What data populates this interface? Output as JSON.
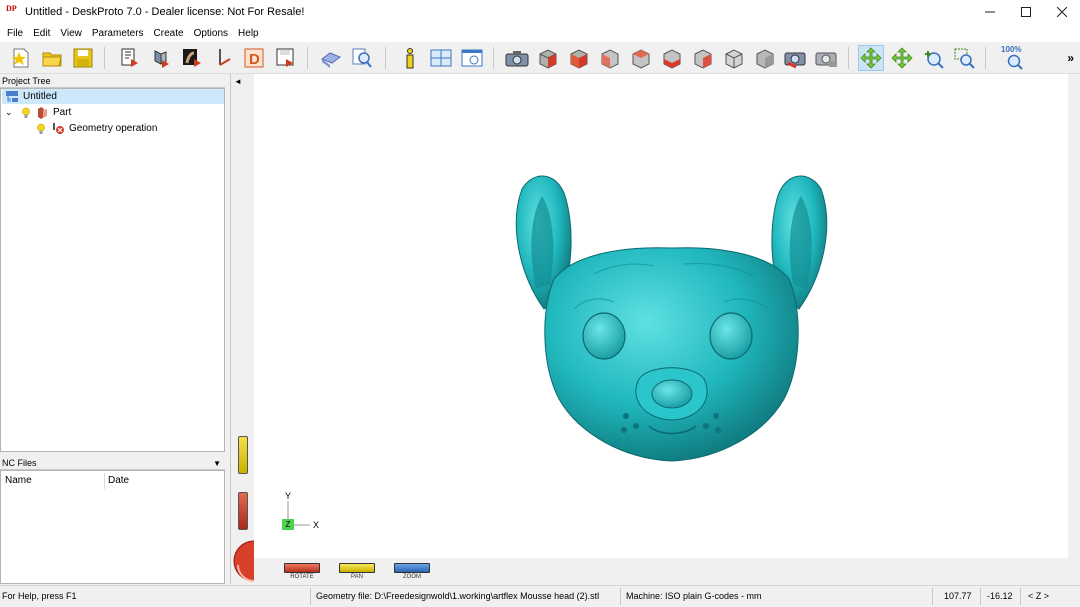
{
  "window": {
    "app_icon_text": "DP",
    "title": "Untitled - DeskProto 7.0 - Dealer license: Not For Resale!",
    "controls": [
      "minimize",
      "maximize",
      "close"
    ]
  },
  "menu": [
    "File",
    "Edit",
    "View",
    "Parameters",
    "Create",
    "Options",
    "Help"
  ],
  "toolbar": {
    "buttons": [
      "new-project-icon",
      "open-project-icon",
      "save-project-icon",
      "wizard-2d-icon",
      "wizard-3d-icon",
      "wizard-bitmap-icon",
      "wizard-vector-icon",
      "wizard-d-icon",
      "wizard-save-icon",
      "sheet-icon",
      "search-icon",
      "info-icon",
      "layout-icon",
      "window-icon",
      "camera-icon",
      "view-cube-1-icon",
      "view-cube-2-icon",
      "view-cube-3-icon",
      "view-cube-4-icon",
      "view-cube-5-icon",
      "view-cube-6-icon",
      "view-cube-7-icon",
      "view-cube-8-icon",
      "camera-red-icon",
      "camera-gray-icon",
      "rotate-icon",
      "pan-icon",
      "zoom-in-icon",
      "zoom-window-icon",
      "zoom-100-icon"
    ],
    "zoom_label": "100%",
    "more": "»"
  },
  "project_tree": {
    "header": "Project Tree",
    "items": [
      {
        "label": "Untitled",
        "level": 0,
        "selected": true
      },
      {
        "label": "Part",
        "level": 1,
        "selected": false
      },
      {
        "label": "Geometry operation",
        "level": 2,
        "selected": false
      }
    ]
  },
  "nc_files": {
    "header": "NC Files",
    "columns": [
      "Name",
      "Date"
    ]
  },
  "viewport": {
    "model_color": "#20b8bd",
    "axis_y": "Y",
    "axis_z": "Z",
    "axis_x": "X",
    "controls": [
      {
        "label": "ROTATE",
        "color": "#d9402a"
      },
      {
        "label": "PAN",
        "color": "#e6d21a"
      },
      {
        "label": "ZOOM",
        "color": "#3a7fd0"
      }
    ]
  },
  "statusbar": {
    "help": "For Help, press F1",
    "geometry": "Geometry file: D:\\Freedesignwold\\1.working\\artflex Mousse head (2).stl",
    "machine": "Machine: ISO plain G-codes - mm",
    "x": "107.77",
    "y": "-16.12",
    "axis": "< Z >"
  }
}
